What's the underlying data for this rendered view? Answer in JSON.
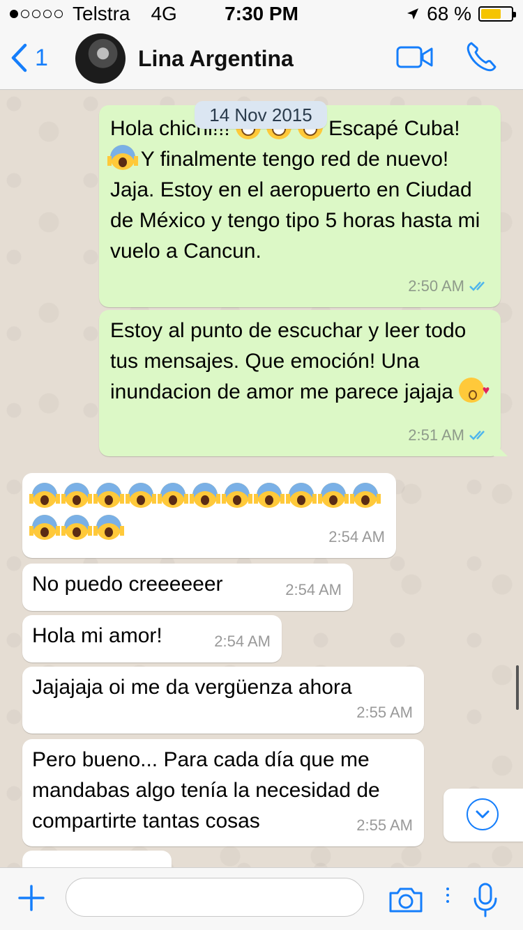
{
  "status": {
    "carrier": "Telstra",
    "network": "4G",
    "time": "7:30 PM",
    "battery_pct": "68 %",
    "battery_level": 0.68,
    "signal_bars_filled": 1
  },
  "header": {
    "back_count": "1",
    "contact_name": "Lina Argentina"
  },
  "chat": {
    "date": "14 Nov 2015",
    "messages": [
      {
        "text_before": "Hola chichi!!! ",
        "text_after": "  Escapé Cuba! ",
        "text_after2": " Y finalmente tengo red de nuevo! Jaja. Estoy en el aeropuerto en Ciudad de México y tengo tipo 5 horas hasta mi vuelo a Cancun.",
        "time": "2:50 AM",
        "direction": "out"
      },
      {
        "text": "Estoy al punto de escuchar y leer todo tus mensajes. Que emoción! Una inundacion de amor me parece jajaja ",
        "time": "2:51 AM",
        "direction": "out"
      },
      {
        "emoji_count": 14,
        "time": "2:54 AM",
        "direction": "in"
      },
      {
        "text": "No puedo creeeeeer",
        "time": "2:54 AM",
        "direction": "in"
      },
      {
        "text": "Hola mi amor!",
        "time": "2:54 AM",
        "direction": "in"
      },
      {
        "text": "Jajajaja oi me da vergüenza ahora",
        "time": "2:55 AM",
        "direction": "in"
      },
      {
        "text": "Pero bueno... Para cada día que me mandabas algo tenía la necesidad de compartirte tantas cosas",
        "time": "2:55 AM",
        "direction": "in"
      }
    ]
  },
  "input": {
    "placeholder": ""
  },
  "colors": {
    "accent": "#157efb",
    "outgoing_bubble": "#dcf8c6",
    "incoming_bubble": "#ffffff",
    "read_ticks": "#4fb6ec"
  }
}
